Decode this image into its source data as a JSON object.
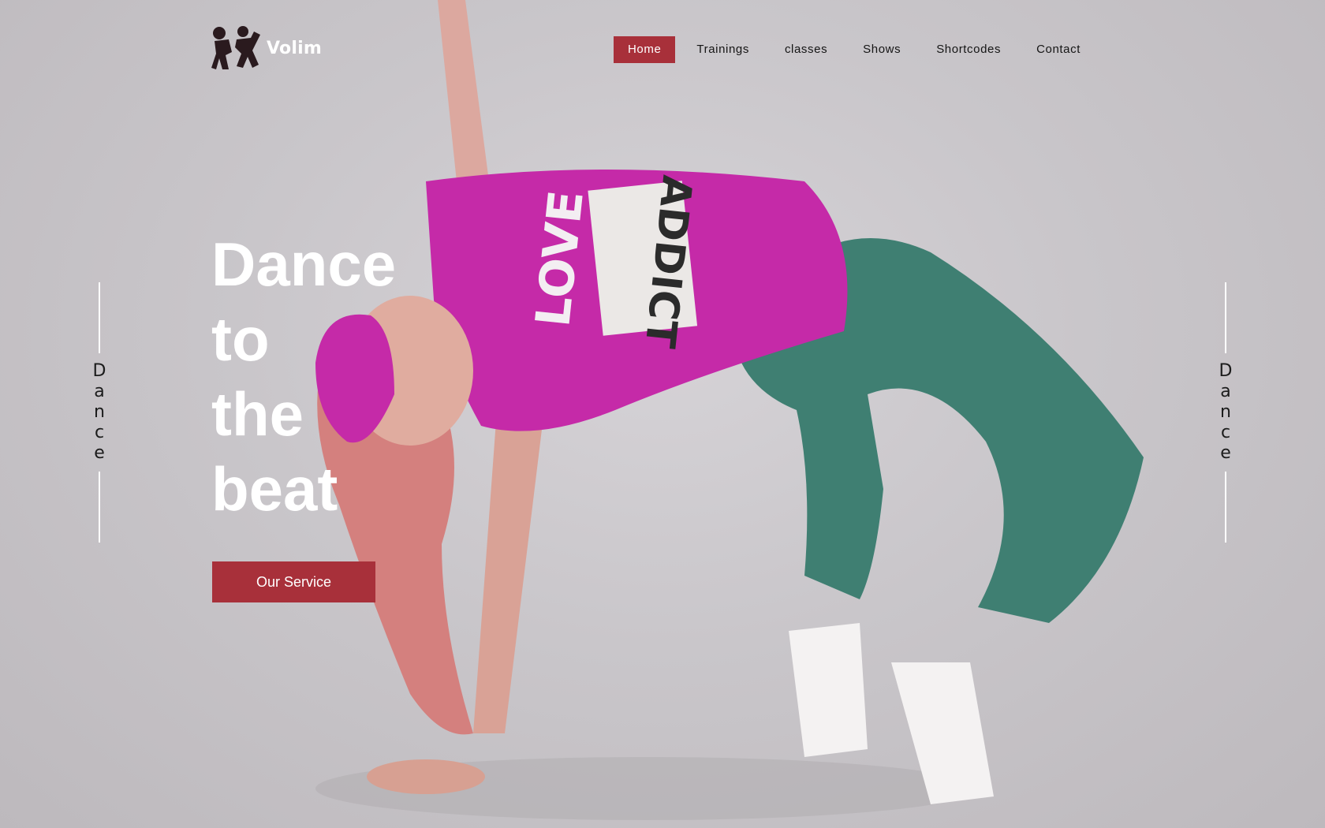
{
  "brand": {
    "name": "Volim",
    "logo_icon": "two-dancers-icon"
  },
  "nav": {
    "items": [
      {
        "label": "Home",
        "active": true
      },
      {
        "label": "Trainings",
        "active": false
      },
      {
        "label": "classes",
        "active": false
      },
      {
        "label": "Shows",
        "active": false
      },
      {
        "label": "Shortcodes",
        "active": false
      },
      {
        "label": "Contact",
        "active": false
      }
    ]
  },
  "hero": {
    "headline": [
      "Dance",
      "to",
      "the",
      "beat"
    ],
    "cta_label": "Our Service",
    "shirt_text_1": "LOVE",
    "shirt_text_2": "ADDICT"
  },
  "side_label": {
    "left": "Dance",
    "right": "Dance"
  },
  "colors": {
    "accent": "#a8303a",
    "shirt": "#c52aa8",
    "jeans": "#3f7f72",
    "background": "#c9c6ca"
  }
}
